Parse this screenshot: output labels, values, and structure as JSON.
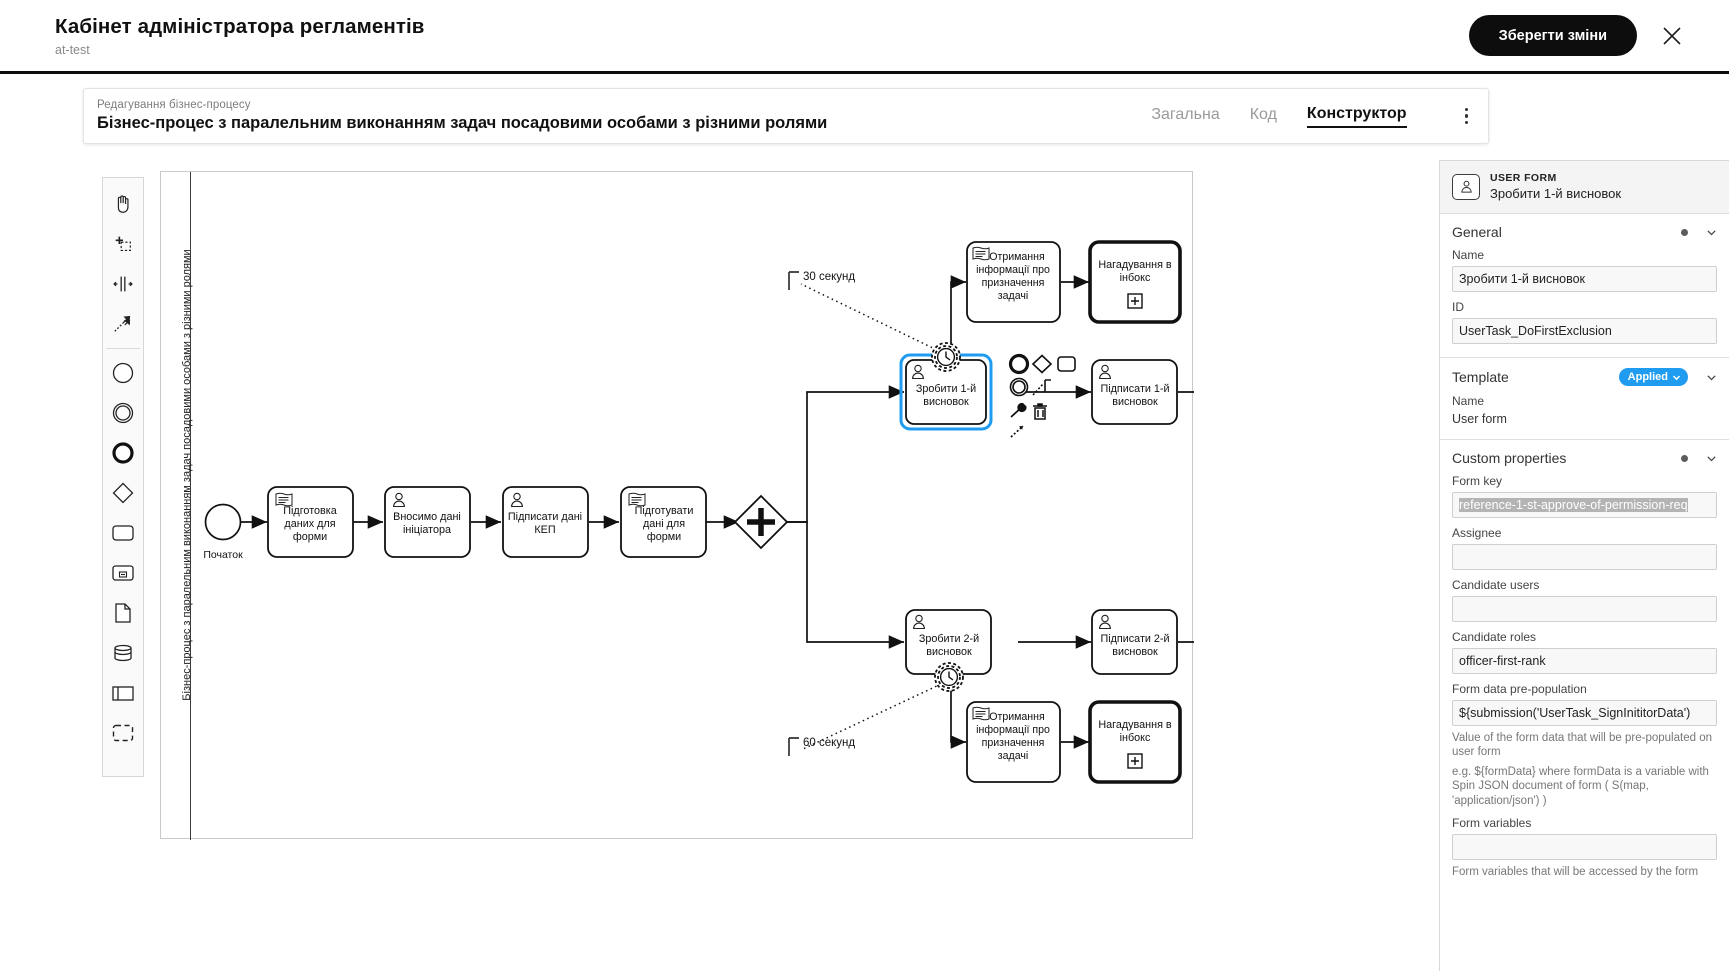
{
  "header": {
    "title": "Кабінет адміністратора регламентів",
    "subtitle": "at-test",
    "save_label": "Зберегти зміни",
    "close_icon": "close-icon",
    "accent": "#0d0d0d"
  },
  "subheader": {
    "kicker": "Редагування бізнес-процесу",
    "name": "Бізнес-процес з паралельним виконанням задач посадовими особами з різними ролями",
    "tabs": [
      {
        "label": "Загальна",
        "active": false
      },
      {
        "label": "Код",
        "active": false
      },
      {
        "label": "Конструктор",
        "active": true
      }
    ],
    "menu_icon": "kebab-menu-icon"
  },
  "palette": [
    {
      "name": "hand-tool-icon"
    },
    {
      "name": "lasso-tool-icon"
    },
    {
      "name": "space-tool-icon"
    },
    {
      "name": "connect-tool-icon"
    },
    {
      "name": "start-event-icon"
    },
    {
      "name": "intermediate-event-icon"
    },
    {
      "name": "end-event-icon"
    },
    {
      "name": "gateway-icon"
    },
    {
      "name": "task-icon"
    },
    {
      "name": "subprocess-icon"
    },
    {
      "name": "data-object-icon"
    },
    {
      "name": "data-store-icon"
    },
    {
      "name": "pool-icon"
    },
    {
      "name": "group-icon"
    }
  ],
  "diagram": {
    "lane_label": "Бізнес-процес з паралельним виконанням задач посадовими особами з різними ролями",
    "start_event_label": "Початок",
    "timers": [
      {
        "label": "30 секунд"
      },
      {
        "label": "60 секунд"
      }
    ],
    "tasks": [
      {
        "id": "t1",
        "label": "Підготовка даних для форми",
        "type": "script"
      },
      {
        "id": "t2",
        "label": "Вносимо дані ініціатора",
        "type": "user"
      },
      {
        "id": "t3",
        "label": "Підписати дані КЕП",
        "type": "user"
      },
      {
        "id": "t4",
        "label": "Підготувати дані для форми",
        "type": "script"
      },
      {
        "id": "t5",
        "label": "Зробити 1-й висновок",
        "type": "user",
        "selected": true
      },
      {
        "id": "t6",
        "label": "Підписати 1-й висновок",
        "type": "user"
      },
      {
        "id": "t7",
        "label": "Зробити 2-й висновок",
        "type": "user"
      },
      {
        "id": "t8",
        "label": "Підписати 2-й висновок",
        "type": "user"
      },
      {
        "id": "t9",
        "label": "Отримання інформації про призначення задачі",
        "type": "script"
      },
      {
        "id": "t10",
        "label": "Нагадування в інбокс",
        "type": "callactivity"
      },
      {
        "id": "t11",
        "label": "Отримання інформації про призначення задачі",
        "type": "script"
      },
      {
        "id": "t12",
        "label": "Нагадування в інбокс",
        "type": "callactivity"
      }
    ],
    "context_pad": [
      "end-event-icon",
      "gateway-icon",
      "task-icon",
      "intermediate-event-icon",
      "text-annotation-icon",
      "wrench-icon",
      "trash-icon",
      "connect-icon"
    ],
    "selection_color": "#1f9cf0"
  },
  "properties": {
    "element_type": "USER FORM",
    "element_name": "Зробити 1-й висновок",
    "element_icon": "user-form-icon",
    "groups": [
      {
        "title": "General"
      },
      {
        "title": "Template"
      },
      {
        "title": "Custom properties"
      }
    ],
    "general": {
      "title": "General",
      "name_label": "Name",
      "name_value": "Зробити 1-й висновок",
      "id_label": "ID",
      "id_value": "UserTask_DoFirstExclusion"
    },
    "template": {
      "title": "Template",
      "badge": "Applied",
      "badge_color": "#1f9cf0",
      "name_label": "Name",
      "name_value": "User form"
    },
    "custom": {
      "title": "Custom properties",
      "form_key_label": "Form key",
      "form_key_value": "reference-1-st-approve-of-permission-req",
      "assignee_label": "Assignee",
      "assignee_value": "",
      "candidate_users_label": "Candidate users",
      "candidate_users_value": "",
      "candidate_roles_label": "Candidate roles",
      "candidate_roles_value": "officer-first-rank",
      "prepopulation_label": "Form data pre-population",
      "prepopulation_value": "${submission('UserTask_SignInititorData')",
      "prepopulation_hint1": "Value of the form data that will be pre-populated on user form",
      "prepopulation_hint2": "e.g. ${formData} where formData is a variable with Spin JSON document of form ( S(map, 'application/json') )",
      "form_variables_label": "Form variables",
      "form_variables_value": "",
      "form_variables_hint": "Form variables that will be accessed by the form"
    }
  }
}
